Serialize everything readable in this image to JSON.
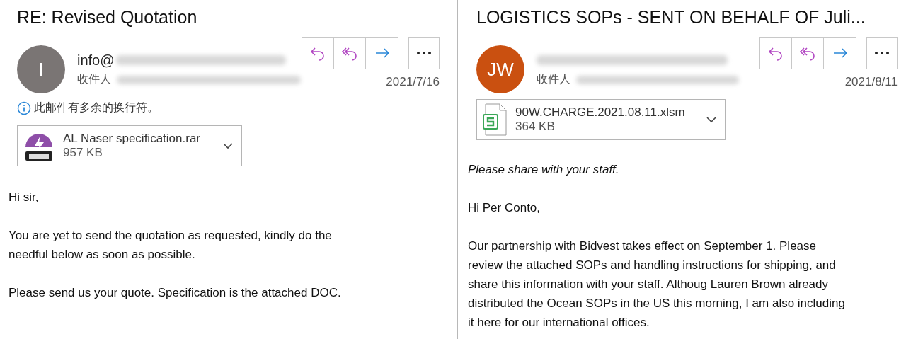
{
  "panes": [
    {
      "subject": "RE: Revised Quotation",
      "avatar": {
        "initials": "I",
        "color": "#7a7574"
      },
      "sender": "info@",
      "to_label": "收件人",
      "date": "2021/7/16",
      "notice": "此邮件有多余的换行符。",
      "attachment": {
        "kind": "rar",
        "name": "AL Naser specification.rar",
        "size": "957 KB"
      },
      "paragraphs": [
        {
          "kind": "normal",
          "lines": [
            "Hi sir,"
          ]
        },
        {
          "kind": "normal",
          "lines": [
            "You are yet to send the quotation as requested, kindly do the",
            "needful below as soon as possible."
          ]
        },
        {
          "kind": "normal",
          "lines": [
            "Please send us your quote. Specification is the attached DOC."
          ]
        }
      ]
    },
    {
      "subject": "LOGISTICS SOPs - SENT ON BEHALF OF Juli...",
      "avatar": {
        "initials": "JW",
        "color": "#ca5010"
      },
      "to_label": "收件人",
      "date": "2021/8/11",
      "attachment": {
        "kind": "xlsm",
        "name": "90W.CHARGE.2021.08.11.xlsm",
        "size": "364 KB"
      },
      "paragraphs": [
        {
          "kind": "note",
          "lines": [
            "Please share with your staff."
          ]
        },
        {
          "kind": "normal",
          "lines": [
            "Hi Per Conto,"
          ]
        },
        {
          "kind": "normal",
          "lines": [
            "Our partnership with Bidvest takes effect on September 1. Please",
            "review the attached SOPs and handling instructions for shipping, and",
            "share this information with your staff. Althoug Lauren Brown already",
            "distributed the Ocean SOPs in the US this morning, I am also including",
            "it here for our international offices."
          ]
        }
      ]
    }
  ]
}
